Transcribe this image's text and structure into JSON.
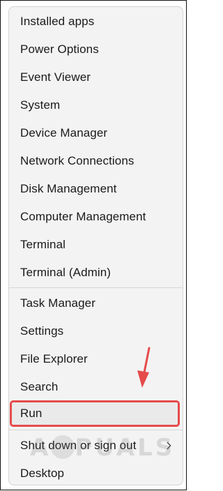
{
  "menu": {
    "group1": [
      {
        "name": "installed-apps",
        "label": "Installed apps"
      },
      {
        "name": "power-options",
        "label": "Power Options"
      },
      {
        "name": "event-viewer",
        "label": "Event Viewer"
      },
      {
        "name": "system",
        "label": "System"
      },
      {
        "name": "device-manager",
        "label": "Device Manager"
      },
      {
        "name": "network-connections",
        "label": "Network Connections"
      },
      {
        "name": "disk-management",
        "label": "Disk Management"
      },
      {
        "name": "computer-management",
        "label": "Computer Management"
      },
      {
        "name": "terminal",
        "label": "Terminal"
      },
      {
        "name": "terminal-admin",
        "label": "Terminal (Admin)"
      }
    ],
    "group2": [
      {
        "name": "task-manager",
        "label": "Task Manager"
      },
      {
        "name": "settings",
        "label": "Settings"
      },
      {
        "name": "file-explorer",
        "label": "File Explorer"
      },
      {
        "name": "search",
        "label": "Search"
      },
      {
        "name": "run",
        "label": "Run"
      }
    ],
    "group3": [
      {
        "name": "shut-down",
        "label": "Shut down or sign out",
        "submenu_icon": "chevron-right-icon"
      },
      {
        "name": "desktop",
        "label": "Desktop"
      }
    ]
  },
  "annotation": {
    "highlight_color": "#e64b4b",
    "arrow_color": "#e64b4b",
    "highlighted_item": "Run"
  },
  "watermark": {
    "text": "APPUALS"
  }
}
